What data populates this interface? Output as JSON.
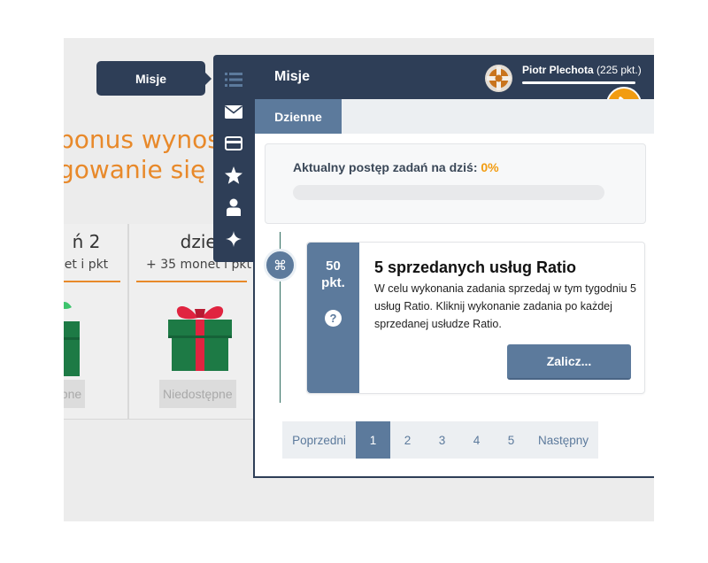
{
  "background": {
    "heading_line1": "bonus wynos",
    "heading_line2": "gowanie się c",
    "day_cards": [
      {
        "title": "ń 2",
        "subtitle": "et i pkt",
        "status": "ępne"
      },
      {
        "title": "dzień",
        "subtitle": "+ 35 monet i pkt",
        "status": "Niedostępne"
      }
    ]
  },
  "tooltip": {
    "label": "Misje"
  },
  "side_nav": {
    "items": [
      {
        "icon": "list-icon",
        "label": "Misje"
      },
      {
        "icon": "envelope-icon"
      },
      {
        "icon": "card-icon"
      },
      {
        "icon": "star-icon"
      },
      {
        "icon": "user-icon"
      },
      {
        "icon": "sparkle-icon"
      }
    ]
  },
  "panel": {
    "title": "Misje",
    "user": {
      "name": "Piotr Plechota",
      "points": "(225 pkt.)"
    },
    "tabs": [
      {
        "label": "Dzienne",
        "active": true
      }
    ],
    "progress": {
      "label": "Aktualny postęp zadań na dziś:",
      "value": "0%",
      "fraction": 0.0
    },
    "task": {
      "timeline_icon": "⌘",
      "points_value": "50",
      "points_unit": "pkt.",
      "help": "?",
      "title": "5 sprzedanych usług Ratio",
      "description": "W celu wykonania zadania sprzedaj w tym tygodniu 5 usług Ratio. Kliknij wykonanie zadania po każdej sprzedanej usłudze Ratio.",
      "button": "Zalicz..."
    },
    "pagination": {
      "prev": "Poprzedni",
      "pages": [
        "1",
        "2",
        "3",
        "4",
        "5"
      ],
      "active_index": 0,
      "next": "Następny"
    }
  },
  "colors": {
    "navy": "#2e3e57",
    "steel_blue": "#5c7a9c",
    "orange": "#f29c11",
    "heading_orange": "#e8892a"
  }
}
